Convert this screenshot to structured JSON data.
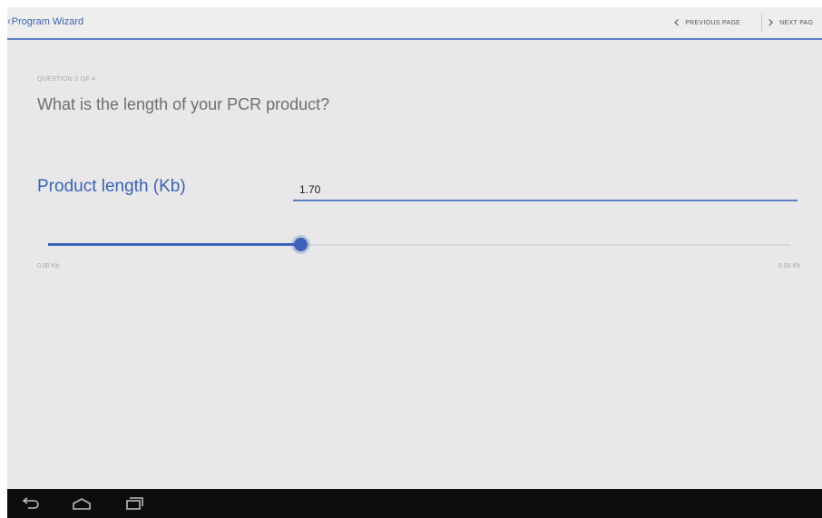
{
  "header": {
    "back_label": "Program Wizard",
    "previous_label": "PREVIOUS PAGE",
    "next_label": "NEXT PAG"
  },
  "question": {
    "counter": "QUESTION 2 OF 4",
    "title": "What is the length of your PCR product?"
  },
  "field": {
    "label": "Product length (Kb)",
    "value": "1.70"
  },
  "slider": {
    "min_label": "0.00 Kb",
    "max_label": "5.00 Kb",
    "min": 0,
    "max": 5,
    "value": 1.7
  },
  "system_bar": {
    "icons": [
      "back-icon",
      "home-icon",
      "recent-apps-icon"
    ]
  },
  "colors": {
    "accent": "#3a62b8",
    "background": "#e8e8e8",
    "system_bar": "#0d0d0d"
  }
}
